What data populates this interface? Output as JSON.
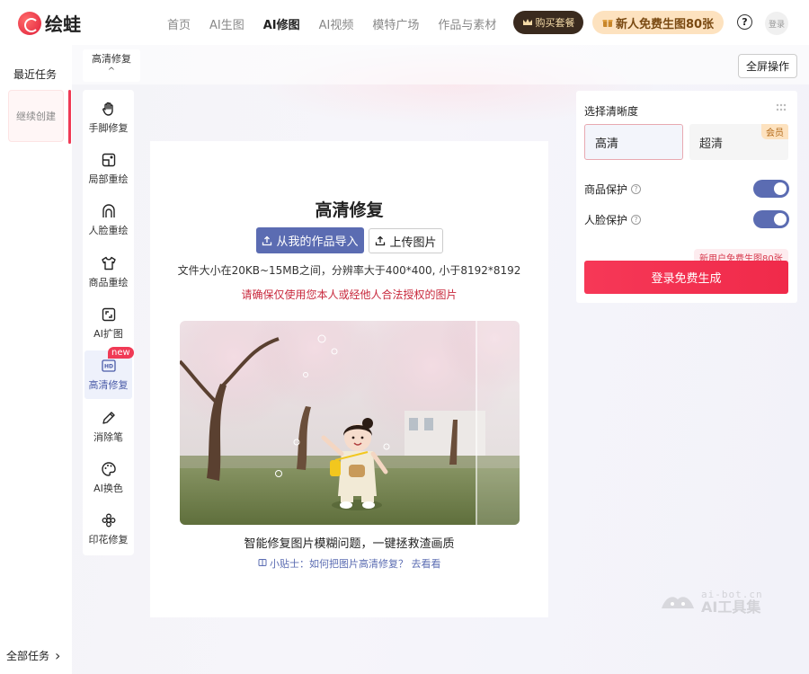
{
  "header": {
    "logo_text": "绘蛙",
    "nav": [
      "首页",
      "AI生图",
      "AI修图",
      "AI视频",
      "模特广场",
      "作品与素材"
    ],
    "nav_active_index": 2,
    "buy_label": "购买套餐",
    "newuser_label": "新人免费生图80张",
    "help_glyph": "?",
    "login_label": "登录"
  },
  "recent": {
    "title": "最近任务",
    "continue_label": "继续创建",
    "all_tasks_label": "全部任务",
    "chevron": "›"
  },
  "toolbar": {
    "selector_label": "高清修复",
    "selector_chevron": "^",
    "fullscreen_label": "全屏操作"
  },
  "tools": [
    {
      "label": "手脚修复",
      "icon": "hand-icon"
    },
    {
      "label": "局部重绘",
      "icon": "partial-redraw-icon"
    },
    {
      "label": "人脸重绘",
      "icon": "face-icon"
    },
    {
      "label": "商品重绘",
      "icon": "shirt-icon"
    },
    {
      "label": "AI扩图",
      "icon": "expand-icon"
    },
    {
      "label": "高清修复",
      "icon": "hd-icon",
      "active": true,
      "badge": "new"
    },
    {
      "label": "消除笔",
      "icon": "pen-icon"
    },
    {
      "label": "AI换色",
      "icon": "palette-icon"
    },
    {
      "label": "印花修复",
      "icon": "flower-icon"
    }
  ],
  "upload": {
    "title": "高清修复",
    "import_label": "从我的作品导入",
    "upload_label": "上传图片",
    "file_requirements": "文件大小在20KB~15MB之间，分辨率大于400*400, 小于8192*8192",
    "rights_warning": "请确保仅使用您本人或经他人合法授权的图片",
    "caption": "智能修复图片模糊问题，一键拯救渣画质",
    "tip": "小贴士：如何把图片高清修复？  去看看"
  },
  "settings": {
    "title": "选择清晰度",
    "options": [
      {
        "label": "高清",
        "selected": true
      },
      {
        "label": "超清",
        "badge": "会员"
      }
    ],
    "product_protect_label": "商品保护",
    "product_protect_on": true,
    "face_protect_label": "人脸保护",
    "face_protect_on": true,
    "free_tag": "新用户免费生图80张",
    "generate_label": "登录免费生成"
  },
  "watermark": {
    "url": "ai-bot.cn",
    "name": "AI工具集"
  },
  "colors": {
    "accent": "#5b6cb2",
    "brand_red": "#f03a55",
    "gold_bg": "#fde2bf"
  }
}
